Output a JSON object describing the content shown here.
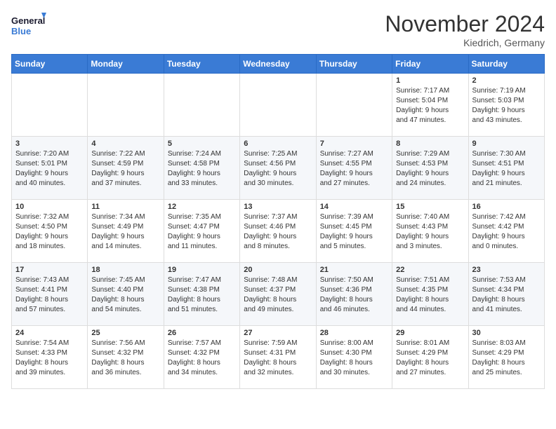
{
  "logo": {
    "line1": "General",
    "line2": "Blue"
  },
  "title": "November 2024",
  "location": "Kiedrich, Germany",
  "weekdays": [
    "Sunday",
    "Monday",
    "Tuesday",
    "Wednesday",
    "Thursday",
    "Friday",
    "Saturday"
  ],
  "weeks": [
    [
      {
        "day": "",
        "info": ""
      },
      {
        "day": "",
        "info": ""
      },
      {
        "day": "",
        "info": ""
      },
      {
        "day": "",
        "info": ""
      },
      {
        "day": "",
        "info": ""
      },
      {
        "day": "1",
        "info": "Sunrise: 7:17 AM\nSunset: 5:04 PM\nDaylight: 9 hours\nand 47 minutes."
      },
      {
        "day": "2",
        "info": "Sunrise: 7:19 AM\nSunset: 5:03 PM\nDaylight: 9 hours\nand 43 minutes."
      }
    ],
    [
      {
        "day": "3",
        "info": "Sunrise: 7:20 AM\nSunset: 5:01 PM\nDaylight: 9 hours\nand 40 minutes."
      },
      {
        "day": "4",
        "info": "Sunrise: 7:22 AM\nSunset: 4:59 PM\nDaylight: 9 hours\nand 37 minutes."
      },
      {
        "day": "5",
        "info": "Sunrise: 7:24 AM\nSunset: 4:58 PM\nDaylight: 9 hours\nand 33 minutes."
      },
      {
        "day": "6",
        "info": "Sunrise: 7:25 AM\nSunset: 4:56 PM\nDaylight: 9 hours\nand 30 minutes."
      },
      {
        "day": "7",
        "info": "Sunrise: 7:27 AM\nSunset: 4:55 PM\nDaylight: 9 hours\nand 27 minutes."
      },
      {
        "day": "8",
        "info": "Sunrise: 7:29 AM\nSunset: 4:53 PM\nDaylight: 9 hours\nand 24 minutes."
      },
      {
        "day": "9",
        "info": "Sunrise: 7:30 AM\nSunset: 4:51 PM\nDaylight: 9 hours\nand 21 minutes."
      }
    ],
    [
      {
        "day": "10",
        "info": "Sunrise: 7:32 AM\nSunset: 4:50 PM\nDaylight: 9 hours\nand 18 minutes."
      },
      {
        "day": "11",
        "info": "Sunrise: 7:34 AM\nSunset: 4:49 PM\nDaylight: 9 hours\nand 14 minutes."
      },
      {
        "day": "12",
        "info": "Sunrise: 7:35 AM\nSunset: 4:47 PM\nDaylight: 9 hours\nand 11 minutes."
      },
      {
        "day": "13",
        "info": "Sunrise: 7:37 AM\nSunset: 4:46 PM\nDaylight: 9 hours\nand 8 minutes."
      },
      {
        "day": "14",
        "info": "Sunrise: 7:39 AM\nSunset: 4:45 PM\nDaylight: 9 hours\nand 5 minutes."
      },
      {
        "day": "15",
        "info": "Sunrise: 7:40 AM\nSunset: 4:43 PM\nDaylight: 9 hours\nand 3 minutes."
      },
      {
        "day": "16",
        "info": "Sunrise: 7:42 AM\nSunset: 4:42 PM\nDaylight: 9 hours\nand 0 minutes."
      }
    ],
    [
      {
        "day": "17",
        "info": "Sunrise: 7:43 AM\nSunset: 4:41 PM\nDaylight: 8 hours\nand 57 minutes."
      },
      {
        "day": "18",
        "info": "Sunrise: 7:45 AM\nSunset: 4:40 PM\nDaylight: 8 hours\nand 54 minutes."
      },
      {
        "day": "19",
        "info": "Sunrise: 7:47 AM\nSunset: 4:38 PM\nDaylight: 8 hours\nand 51 minutes."
      },
      {
        "day": "20",
        "info": "Sunrise: 7:48 AM\nSunset: 4:37 PM\nDaylight: 8 hours\nand 49 minutes."
      },
      {
        "day": "21",
        "info": "Sunrise: 7:50 AM\nSunset: 4:36 PM\nDaylight: 8 hours\nand 46 minutes."
      },
      {
        "day": "22",
        "info": "Sunrise: 7:51 AM\nSunset: 4:35 PM\nDaylight: 8 hours\nand 44 minutes."
      },
      {
        "day": "23",
        "info": "Sunrise: 7:53 AM\nSunset: 4:34 PM\nDaylight: 8 hours\nand 41 minutes."
      }
    ],
    [
      {
        "day": "24",
        "info": "Sunrise: 7:54 AM\nSunset: 4:33 PM\nDaylight: 8 hours\nand 39 minutes."
      },
      {
        "day": "25",
        "info": "Sunrise: 7:56 AM\nSunset: 4:32 PM\nDaylight: 8 hours\nand 36 minutes."
      },
      {
        "day": "26",
        "info": "Sunrise: 7:57 AM\nSunset: 4:32 PM\nDaylight: 8 hours\nand 34 minutes."
      },
      {
        "day": "27",
        "info": "Sunrise: 7:59 AM\nSunset: 4:31 PM\nDaylight: 8 hours\nand 32 minutes."
      },
      {
        "day": "28",
        "info": "Sunrise: 8:00 AM\nSunset: 4:30 PM\nDaylight: 8 hours\nand 30 minutes."
      },
      {
        "day": "29",
        "info": "Sunrise: 8:01 AM\nSunset: 4:29 PM\nDaylight: 8 hours\nand 27 minutes."
      },
      {
        "day": "30",
        "info": "Sunrise: 8:03 AM\nSunset: 4:29 PM\nDaylight: 8 hours\nand 25 minutes."
      }
    ]
  ]
}
